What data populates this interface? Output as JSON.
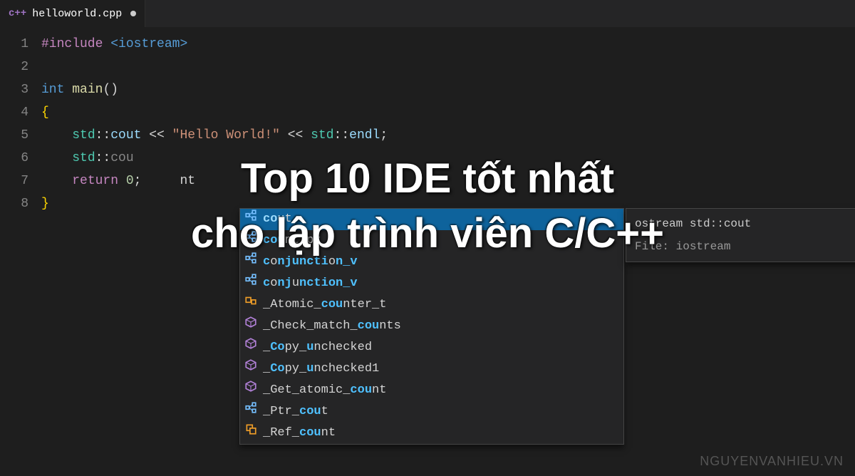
{
  "tab": {
    "icon_label": "c++",
    "filename": "helloworld.cpp",
    "dirty": true
  },
  "code": {
    "lines": [
      "1",
      "2",
      "3",
      "4",
      "5",
      "6",
      "7",
      "8"
    ],
    "l1": {
      "include": "#include",
      "header": "<iostream>"
    },
    "l3": {
      "type": "int",
      "func": "main",
      "parens": "()"
    },
    "l4": {
      "brace": "{"
    },
    "l5": {
      "ns": "std",
      "colon": "::",
      "member": "cout",
      "op1": " << ",
      "str": "\"Hello World!\"",
      "op2": " << ",
      "ns2": "std",
      "member2": "endl",
      "semi": ";"
    },
    "l6": {
      "ns": "std",
      "colon": "::",
      "cursor": "cou"
    },
    "l7": {
      "return": "return",
      "num": " 0",
      "semi": ";",
      "obscured": "nt"
    },
    "l8": {
      "brace": "}"
    }
  },
  "autocomplete": {
    "items": [
      {
        "icon": "member",
        "label_parts": [
          "",
          "cou",
          "t"
        ],
        "selected": true
      },
      {
        "icon": "member",
        "label_parts": [
          "",
          "cou",
          "nt_pr"
        ]
      },
      {
        "icon": "member",
        "label_parts": [
          "",
          "c",
          "o",
          "njuncti",
          "o",
          "n_v"
        ]
      },
      {
        "icon": "member",
        "label_parts": [
          "",
          "c",
          "o",
          "nj",
          "u",
          "nction_v"
        ]
      },
      {
        "icon": "class",
        "label_parts": [
          "_Atomic_",
          "cou",
          "nter_t"
        ]
      },
      {
        "icon": "struct",
        "label_parts": [
          "_Check_match_",
          "cou",
          "nts"
        ]
      },
      {
        "icon": "struct",
        "label_parts": [
          "_",
          "Co",
          "py_",
          "u",
          "nchecked"
        ]
      },
      {
        "icon": "struct",
        "label_parts": [
          "_",
          "Co",
          "py_",
          "u",
          "nchecked1"
        ]
      },
      {
        "icon": "struct",
        "label_parts": [
          "_Get_atomic_",
          "cou",
          "nt"
        ]
      },
      {
        "icon": "member",
        "label_parts": [
          "_Ptr_",
          "cou",
          "t"
        ]
      },
      {
        "icon": "ref",
        "label_parts": [
          "_Ref_",
          "cou",
          "nt"
        ]
      }
    ],
    "detail": {
      "signature_prefix": "ostream std::",
      "signature_name": "cout",
      "file_label": "File:",
      "file_value": "iostream"
    }
  },
  "overlay": {
    "line1": "Top 10 IDE tốt nhất",
    "line2": "cho lập trình viên C/C++"
  },
  "watermark": "NGUYENVANHIEU.VN"
}
